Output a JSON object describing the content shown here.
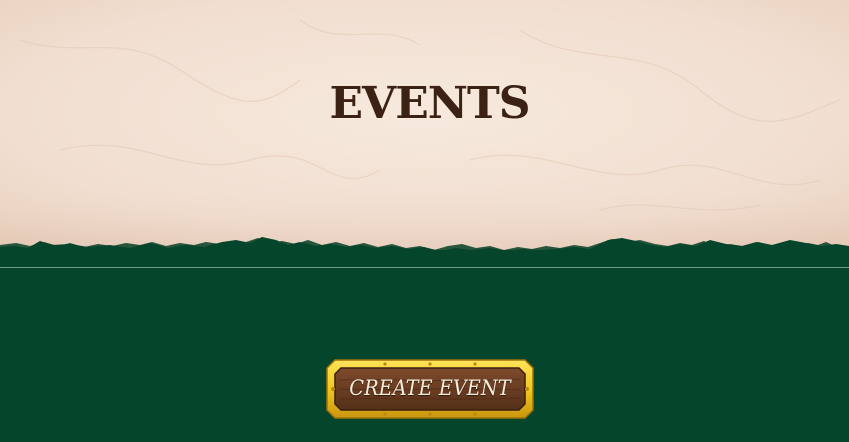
{
  "header": {
    "title": "EVENTS"
  },
  "actions": {
    "create_event_label": "CREATE EVENT"
  },
  "colors": {
    "parchment": "#f3e2d4",
    "title_brown": "#3b2215",
    "background_green": "#04452b",
    "button_wood": "#6b3b22",
    "button_gold_frame": "#f2c81d"
  }
}
